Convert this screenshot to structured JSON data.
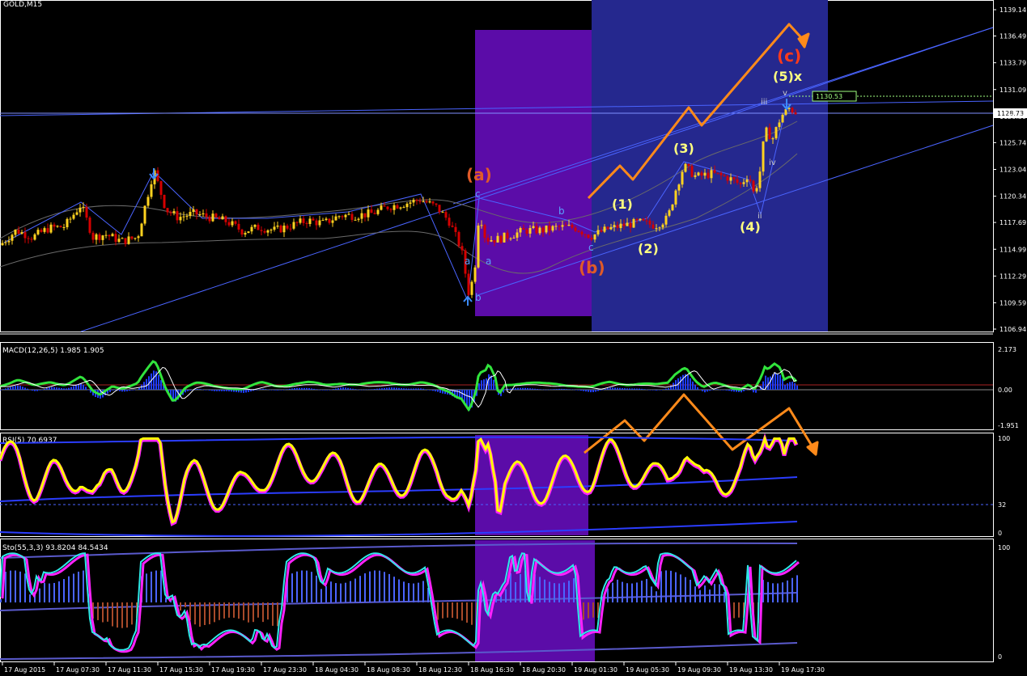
{
  "symbol_label": "GOLD,M15",
  "colors": {
    "background": "#000000",
    "bull_candle": "#ffd21f",
    "bear_candle": "#d40000",
    "channel": "#4a64ff",
    "purple_box": "#5b0ca8",
    "blue_box": "#25288e",
    "orange": "#ff8a1a",
    "yellow_line": "#ffff00",
    "magenta": "#ff22ff",
    "green_macd": "#31e43c",
    "cyan": "#2ee8e8",
    "price_tag": "#a0ff80"
  },
  "price_axis": [
    "1139.14",
    "1136.49",
    "1133.79",
    "1131.09",
    "1128.39",
    "1125.74",
    "1123.04",
    "1120.34",
    "1117.69",
    "1114.99",
    "1112.29",
    "1109.59",
    "1106.94"
  ],
  "price_tags": {
    "level": "1130.53",
    "current": "1128.73"
  },
  "macd": {
    "label": "MACD(12,26,5) 1.985 1.905",
    "axis": [
      "2.173",
      "0.00",
      "-1.951"
    ]
  },
  "rsi": {
    "label": "RSI(5) 70.6937",
    "axis": [
      "100",
      "32",
      "0"
    ]
  },
  "sto": {
    "label": "Sto(55,3,3) 93.8204 84.5434",
    "axis": [
      "100",
      "0"
    ]
  },
  "time_axis": [
    "17 Aug 2015",
    "17 Aug 07:30",
    "17 Aug 11:30",
    "17 Aug 15:30",
    "17 Aug 19:30",
    "17 Aug 23:30",
    "18 Aug 04:30",
    "18 Aug 08:30",
    "18 Aug 12:30",
    "18 Aug 16:30",
    "18 Aug 20:30",
    "19 Aug 01:30",
    "19 Aug 05:30",
    "19 Aug 09:30",
    "19 Aug 13:30",
    "19 Aug 17:30"
  ],
  "wave_labels": {
    "a_orange": "(a)",
    "b_orange": "(b)",
    "c_red": "(c)",
    "five_x": "(5)x",
    "one": "(1)",
    "two": "(2)",
    "three": "(3)",
    "four": "(4)",
    "a1": "a",
    "a2": "a",
    "b1": "b",
    "b2": "b",
    "c1": "c",
    "c2": "c",
    "ii": "ii",
    "iii": "iii",
    "iv": "iv",
    "v": "v"
  },
  "chart_data": {
    "type": "candlestick",
    "symbol": "GOLD",
    "timeframe": "M15",
    "ylim": [
      1106.94,
      1139.14
    ],
    "close_path": [
      [
        0,
        1115.4
      ],
      [
        20,
        1116.9
      ],
      [
        40,
        1116.2
      ],
      [
        60,
        1117.1
      ],
      [
        80,
        1117.3
      ],
      [
        100,
        1119.5
      ],
      [
        115,
        1116.2
      ],
      [
        130,
        1116.5
      ],
      [
        150,
        1115.8
      ],
      [
        170,
        1116.2
      ],
      [
        190,
        1123.0
      ],
      [
        205,
        1119.0
      ],
      [
        220,
        1118.2
      ],
      [
        240,
        1118.6
      ],
      [
        260,
        1118.2
      ],
      [
        280,
        1117.8
      ],
      [
        300,
        1116.8
      ],
      [
        320,
        1117.2
      ],
      [
        340,
        1116.9
      ],
      [
        360,
        1117.4
      ],
      [
        380,
        1117.9
      ],
      [
        400,
        1117.6
      ],
      [
        420,
        1118.4
      ],
      [
        440,
        1118.4
      ],
      [
        460,
        1118.6
      ],
      [
        480,
        1119.3
      ],
      [
        500,
        1119.6
      ],
      [
        520,
        1120.0
      ],
      [
        540,
        1119.2
      ],
      [
        555,
        1117.8
      ],
      [
        570,
        1115.0
      ],
      [
        580,
        1110.2
      ],
      [
        588,
        1114.0
      ],
      [
        592,
        1119.0
      ],
      [
        600,
        1116.0
      ],
      [
        615,
        1116.0
      ],
      [
        630,
        1116.4
      ],
      [
        650,
        1116.9
      ],
      [
        670,
        1116.9
      ],
      [
        690,
        1117.2
      ],
      [
        710,
        1117.2
      ],
      [
        730,
        1116.3
      ],
      [
        750,
        1117.0
      ],
      [
        770,
        1117.4
      ],
      [
        790,
        1117.7
      ],
      [
        810,
        1117.4
      ],
      [
        825,
        1118.1
      ],
      [
        835,
        1121.0
      ],
      [
        845,
        1123.4
      ],
      [
        860,
        1122.3
      ],
      [
        880,
        1122.6
      ],
      [
        900,
        1122.2
      ],
      [
        915,
        1121.5
      ],
      [
        925,
        1122.6
      ],
      [
        932,
        1120.4
      ],
      [
        940,
        1123.2
      ],
      [
        945,
        1127.0
      ],
      [
        955,
        1126.2
      ],
      [
        965,
        1128.4
      ],
      [
        975,
        1129.2
      ],
      [
        985,
        1128.73
      ]
    ],
    "annotations": {
      "horizontal_level": 1130.53,
      "current_price": 1128.73
    },
    "indicators": [
      {
        "name": "MACD(12,26,5)",
        "values": [
          1.985,
          1.905
        ],
        "range": [
          -1.951,
          2.173
        ]
      },
      {
        "name": "RSI(5)",
        "values": [
          70.6937
        ],
        "levels": [
          0,
          32,
          100
        ]
      },
      {
        "name": "Sto(55,3,3)",
        "values": [
          93.8204,
          84.5434
        ],
        "levels": [
          0,
          100
        ]
      }
    ]
  }
}
